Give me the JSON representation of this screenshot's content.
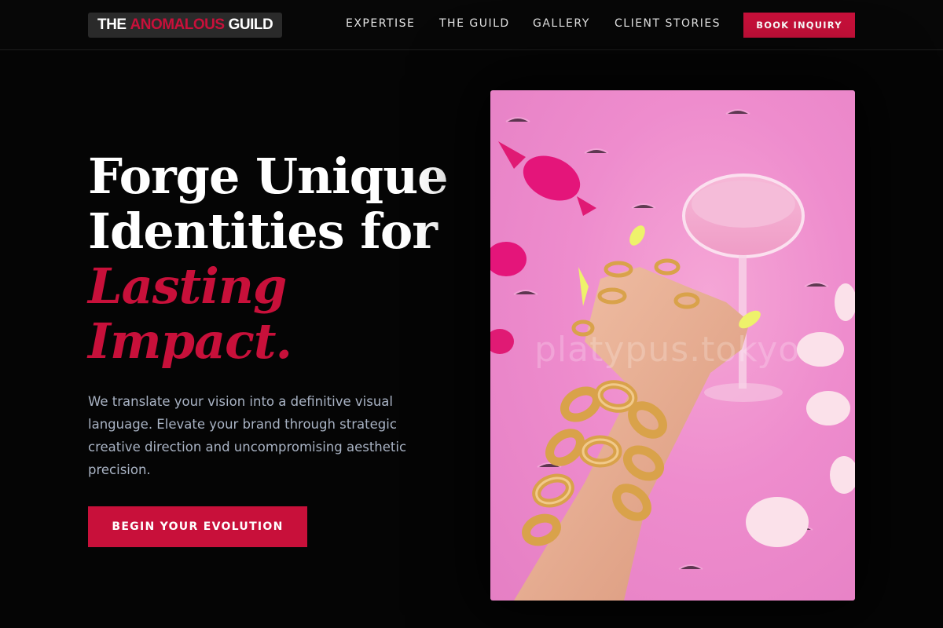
{
  "header": {
    "logo": {
      "part1": "THE",
      "part2": "ANOMALOUS",
      "part3": "GUILD"
    },
    "nav": [
      "EXPERTISE",
      "THE GUILD",
      "GALLERY",
      "CLIENT STORIES"
    ],
    "cta_label": "BOOK INQUIRY"
  },
  "hero": {
    "title_line1": "Forge Unique",
    "title_line2": "Identities for",
    "title_accent1": "Lasting",
    "title_accent2": "Impact.",
    "subtitle": "We translate your vision into a definitive visual language. Elevate your brand through strategic creative direction and uncompromising aesthetic precision.",
    "cta_label": "BEGIN YOUR EVOLUTION",
    "image_watermark": "platypus.tokyo"
  },
  "colors": {
    "accent": "#c8103a",
    "background": "#050505",
    "subtitle": "#a9b3c4"
  }
}
